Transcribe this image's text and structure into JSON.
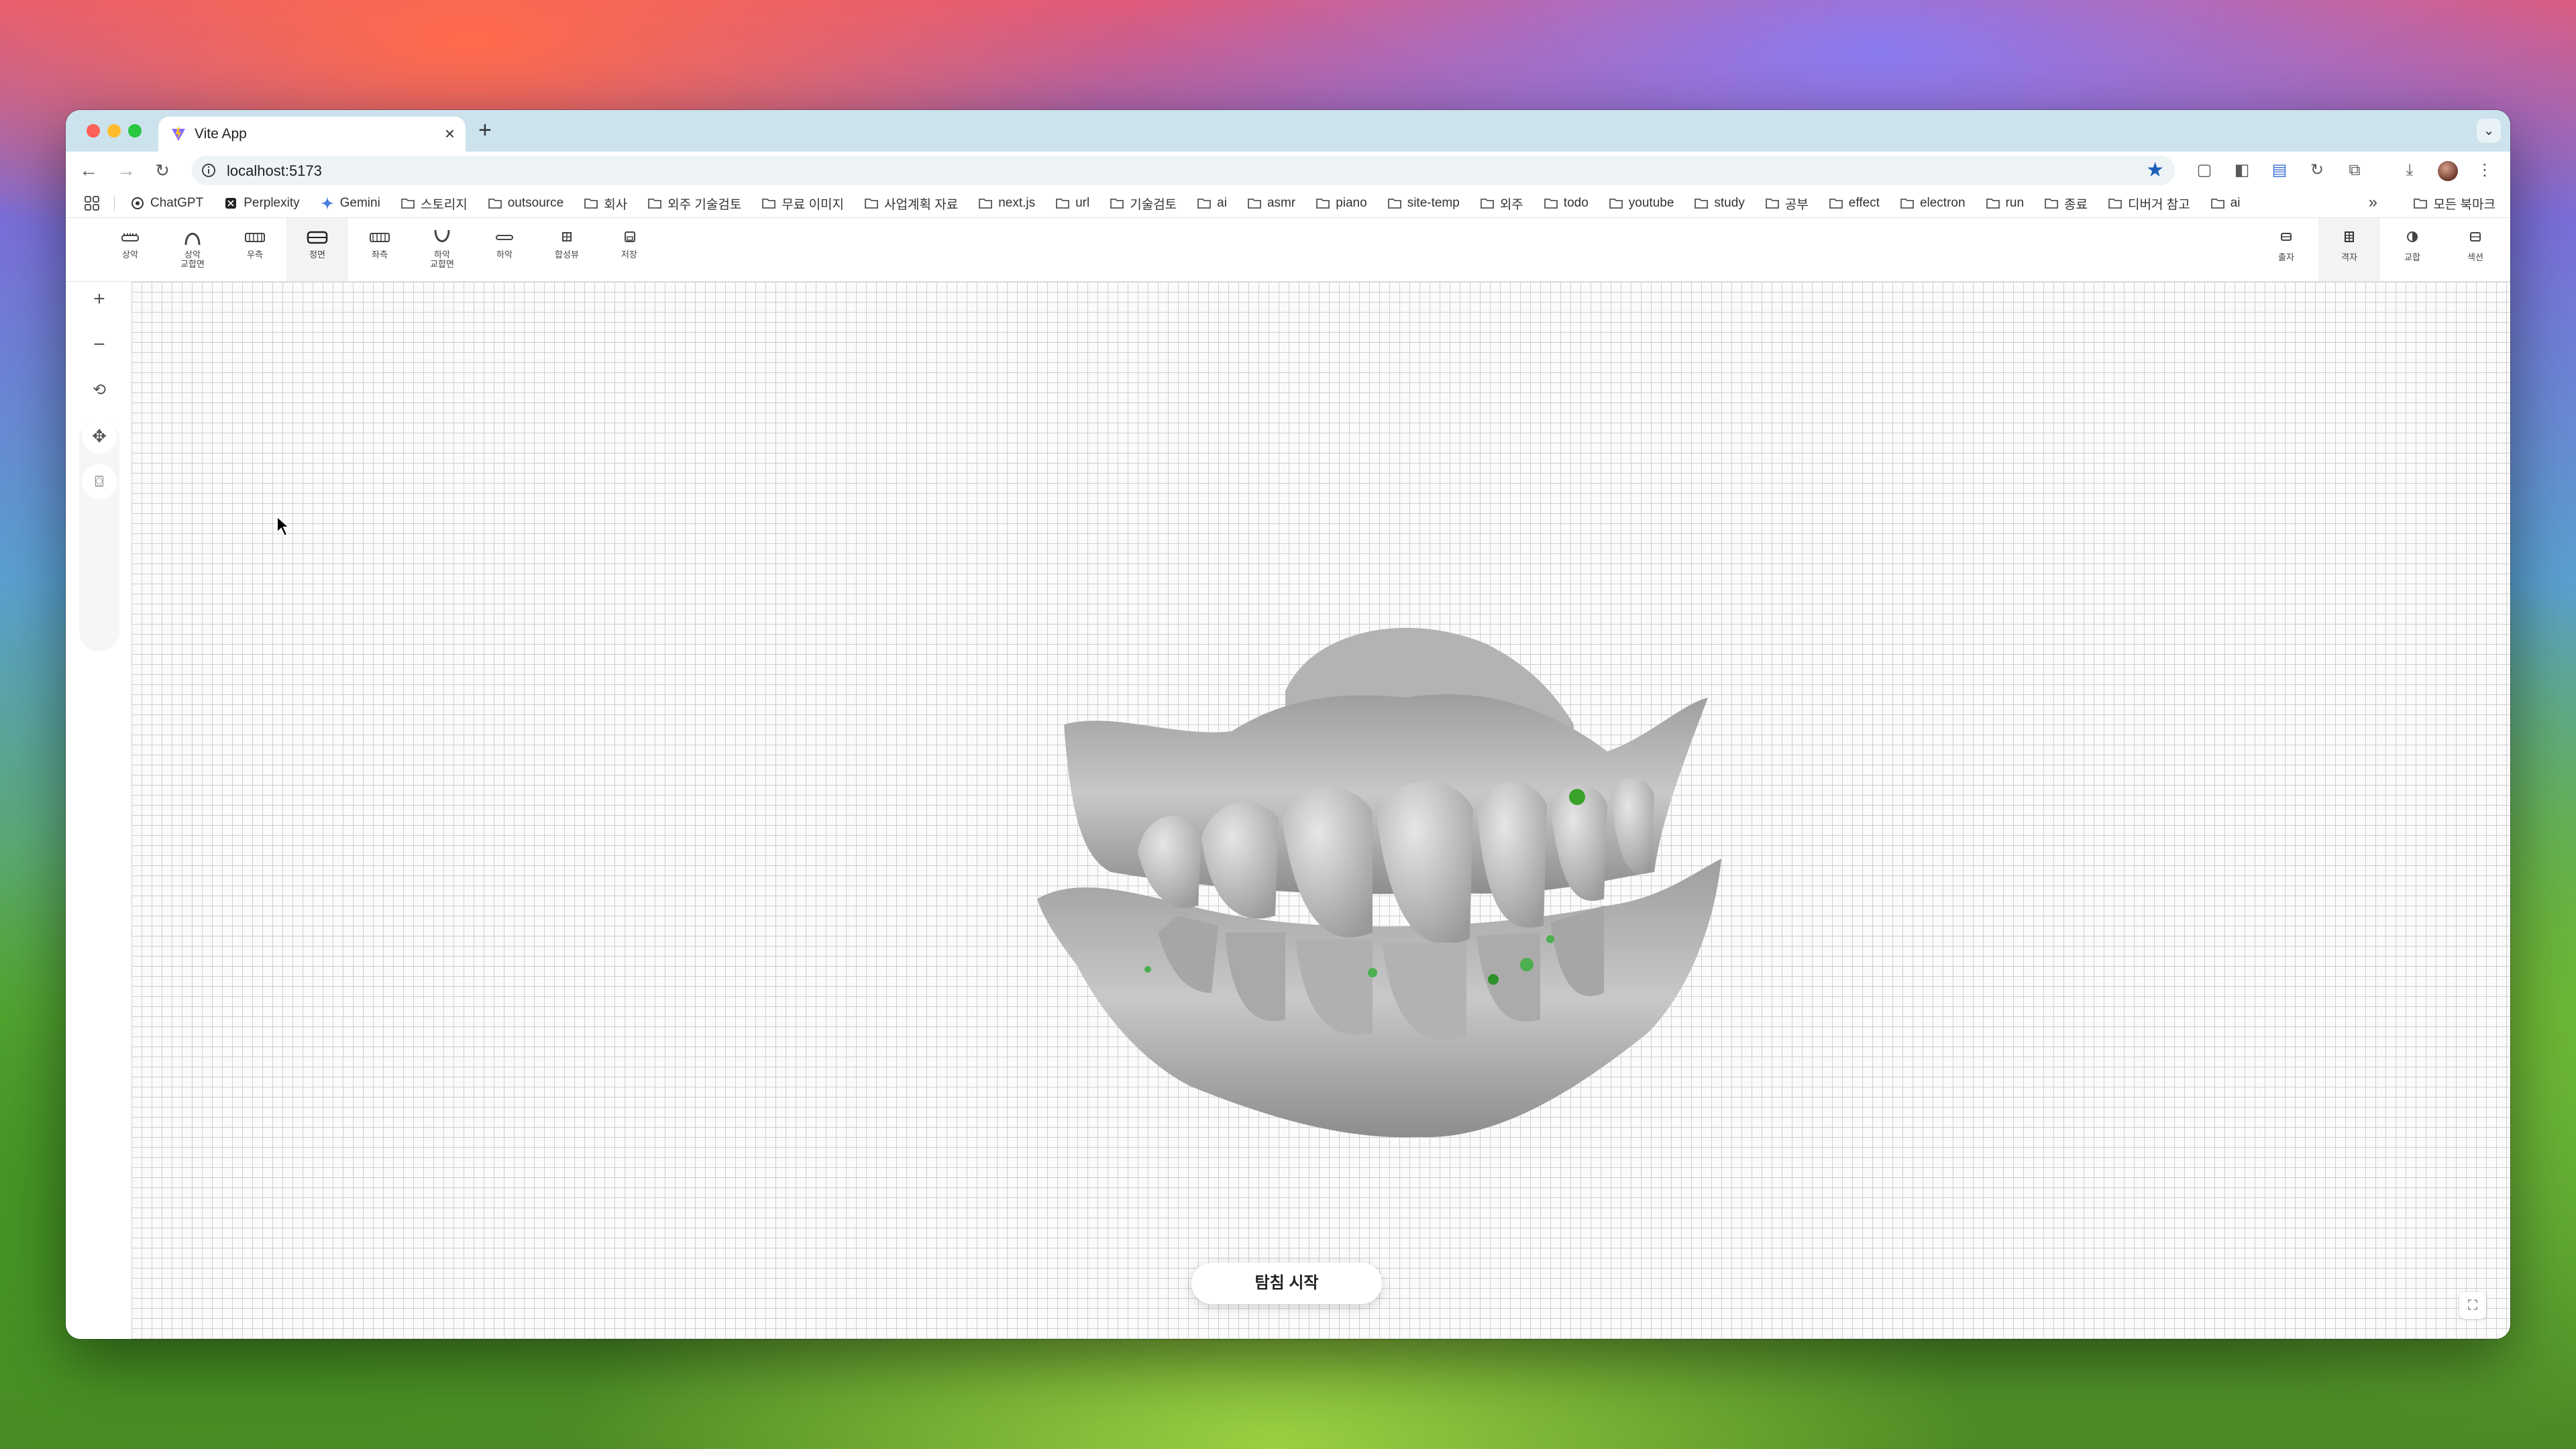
{
  "browser": {
    "tab": {
      "title": "Vite App",
      "close": "×"
    },
    "new_tab": "+",
    "tab_menu": "⌄",
    "address": "localhost:5173",
    "bookmarks": [
      {
        "label": "ChatGPT",
        "icon": "chatgpt-icon"
      },
      {
        "label": "Perplexity",
        "icon": "perplexity-icon"
      },
      {
        "label": "Gemini",
        "icon": "gemini-icon"
      },
      {
        "label": "스토리지",
        "icon": "folder-icon"
      },
      {
        "label": "outsource",
        "icon": "folder-icon"
      },
      {
        "label": "회사",
        "icon": "folder-icon"
      },
      {
        "label": "외주 기술검토",
        "icon": "folder-icon"
      },
      {
        "label": "무료 이미지",
        "icon": "folder-icon"
      },
      {
        "label": "사업계획 자료",
        "icon": "folder-icon"
      },
      {
        "label": "next.js",
        "icon": "folder-icon"
      },
      {
        "label": "url",
        "icon": "folder-icon"
      },
      {
        "label": "기술검토",
        "icon": "folder-icon"
      },
      {
        "label": "ai",
        "icon": "folder-icon"
      },
      {
        "label": "asmr",
        "icon": "folder-icon"
      },
      {
        "label": "piano",
        "icon": "folder-icon"
      },
      {
        "label": "site-temp",
        "icon": "folder-icon"
      },
      {
        "label": "외주",
        "icon": "folder-icon"
      },
      {
        "label": "todo",
        "icon": "folder-icon"
      },
      {
        "label": "youtube",
        "icon": "folder-icon"
      },
      {
        "label": "study",
        "icon": "folder-icon"
      },
      {
        "label": "공부",
        "icon": "folder-icon"
      },
      {
        "label": "effect",
        "icon": "folder-icon"
      },
      {
        "label": "electron",
        "icon": "folder-icon"
      },
      {
        "label": "run",
        "icon": "folder-icon"
      },
      {
        "label": "종료",
        "icon": "folder-icon"
      },
      {
        "label": "디버거 참고",
        "icon": "folder-icon"
      },
      {
        "label": "ai",
        "icon": "folder-icon"
      }
    ],
    "more_bookmarks": "»",
    "all_bookmarks": "모든 북마크"
  },
  "app": {
    "view_tools": {
      "upper": "상악",
      "upper_occlusal_1": "상악",
      "upper_occlusal_2": "교합면",
      "right": "우측",
      "front": "정면",
      "left": "좌측",
      "lower_occlusal_1": "하악",
      "lower_occlusal_2": "교합면",
      "lower": "하악",
      "combined": "합성뷰",
      "save": "저장"
    },
    "right_tools": {
      "print": "출자",
      "grid": "격자",
      "occlusion": "교합",
      "section": "섹션"
    },
    "viewport_controls": {
      "zoom_in": "+",
      "zoom_out": "−"
    },
    "start_button": "탐침 시작",
    "active_tool": "front",
    "colors": {
      "accent": "#4caf50",
      "grid": "#cfcfcf",
      "model": "#b9b9b9"
    }
  }
}
